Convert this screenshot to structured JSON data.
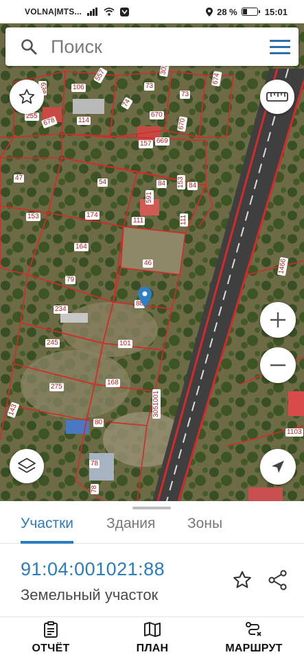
{
  "status_bar": {
    "carrier": "VOLNA|MTS...",
    "battery": "28 %",
    "battery_level": 0.28,
    "time": "15:01"
  },
  "search": {
    "placeholder": "Поиск"
  },
  "map": {
    "parcel_labels": [
      "638",
      "106",
      "557",
      "73",
      "301",
      "73",
      "674",
      "255",
      "678",
      "114",
      "74",
      "670",
      "670",
      "157",
      "669",
      "47",
      "54",
      "84",
      "84",
      "153",
      "153",
      "174",
      "591",
      "111",
      "111",
      "164",
      "46",
      "79",
      "1466",
      "88",
      "234",
      "245",
      "101",
      "168",
      "275",
      "143",
      "80",
      "3051001",
      "78",
      "78",
      "1103"
    ],
    "selected_parcel": "88",
    "colors": {
      "boundary": "#d42a2a",
      "selection": "#2f7fc4"
    }
  },
  "tabs": [
    {
      "label": "Участки",
      "active": true
    },
    {
      "label": "Здания",
      "active": false
    },
    {
      "label": "Зоны",
      "active": false
    }
  ],
  "parcel": {
    "cadastral_number": "91:04:001021:88",
    "type": "Земельный участок"
  },
  "bottom_nav": [
    {
      "label": "ОТЧЁТ",
      "icon": "report-icon"
    },
    {
      "label": "ПЛАН",
      "icon": "map-icon"
    },
    {
      "label": "МАРШРУТ",
      "icon": "route-icon"
    }
  ],
  "accent_color": "#2b7bbf"
}
